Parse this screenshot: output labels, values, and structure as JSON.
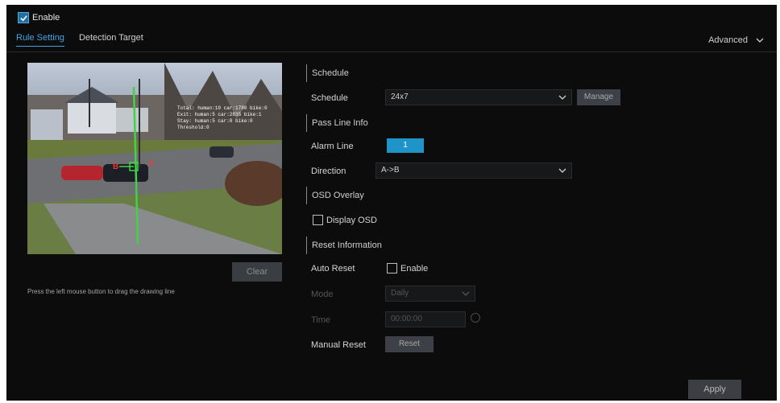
{
  "header": {
    "enable_label": "Enable",
    "enable_checked": true,
    "tabs": [
      {
        "label": "Rule Setting",
        "active": true
      },
      {
        "label": "Detection Target",
        "active": false
      }
    ],
    "advanced_label": "Advanced"
  },
  "preview": {
    "overlay_text": [
      "Total: human:10 car:1780 bike:0",
      "Exit: human:5 car:2835 bike:1",
      "Stay: human:5 car:0 bike:0",
      "Threshold:0"
    ],
    "line_label_a": "A",
    "line_label_b": "B",
    "clear_label": "Clear",
    "hint": "Press the left mouse button to drag the drawing line"
  },
  "schedule": {
    "section_title": "Schedule",
    "label": "Schedule",
    "value": "24x7",
    "manage_label": "Manage"
  },
  "pass_line": {
    "section_title": "Pass Line Info",
    "alarm_line_label": "Alarm Line",
    "alarm_line_value": "1",
    "direction_label": "Direction",
    "direction_value": "A->B"
  },
  "osd": {
    "section_title": "OSD Overlay",
    "display_osd_label": "Display OSD",
    "display_osd_checked": false
  },
  "reset": {
    "section_title": "Reset Information",
    "auto_reset_label": "Auto Reset",
    "enable_label": "Enable",
    "enable_checked": false,
    "mode_label": "Mode",
    "mode_value": "Daily",
    "time_label": "Time",
    "time_value": "00:00:00",
    "manual_reset_label": "Manual Reset",
    "reset_button": "Reset"
  },
  "footer": {
    "apply_label": "Apply"
  },
  "colors": {
    "accent": "#3fa6e6",
    "alarm_line": "#1e94c9",
    "panel_bg": "#0c0c0d",
    "detection_line": "#43d14a"
  }
}
